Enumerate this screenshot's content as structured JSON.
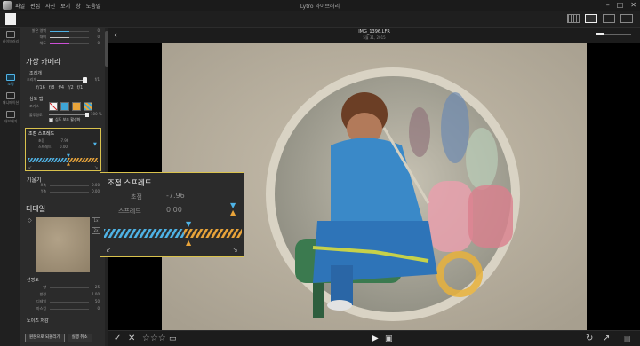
{
  "titlebar": {
    "menu": [
      "파일",
      "편집",
      "사진",
      "보기",
      "창",
      "도움말"
    ],
    "title": "Lytro 라이브러리",
    "controls": [
      "–",
      "□",
      "✕"
    ]
  },
  "rail": {
    "items": [
      {
        "label": "라이브러리",
        "icon": "library-icon"
      },
      {
        "label": "조정",
        "icon": "adjust-icon"
      },
      {
        "label": "애니메이션",
        "icon": "animation-icon"
      },
      {
        "label": "내보내기",
        "icon": "export-icon"
      }
    ]
  },
  "panel": {
    "top_sliders": [
      {
        "label": "밝은 영역",
        "value": "0",
        "color": "#4fb3e6",
        "fill": 0.5
      },
      {
        "label": "대비",
        "value": "0",
        "color": "#c9c9c9",
        "fill": 0.5
      },
      {
        "label": "채도",
        "value": "0",
        "color": "#cc4fd6",
        "fill": 0.5
      }
    ],
    "virtual_camera_title": "가상 카메라",
    "aperture_label": "조리개",
    "aperture_sub": "조리개",
    "aperture_value": "f/1",
    "fstops": [
      "f/16",
      "f/8",
      "f/4",
      "f/2",
      "f/1"
    ],
    "dof_label": "심도 맵",
    "dof_sub_1": "포커스",
    "dof_sub_2": "불투명도",
    "dof_opacity_value": "100 %",
    "dof_checkbox": "심도 보조 활성화",
    "focus_spread_small": {
      "title": "조점 스프레드",
      "focus_label": "초점",
      "focus_value": "-7.96",
      "spread_label": "스프레드",
      "spread_value": "0.00"
    },
    "tilt_title": "기울기",
    "tilt_rows": [
      {
        "label": "X축",
        "value": "0.00"
      },
      {
        "label": "Y축",
        "value": "0.00"
      }
    ],
    "detail_title": "디테일",
    "sharpen_title": "선명도",
    "sharpen_rows": [
      {
        "label": "양",
        "value": "25"
      },
      {
        "label": "반경",
        "value": "1.00"
      },
      {
        "label": "디테일",
        "value": "50"
      },
      {
        "label": "마스킹",
        "value": "0"
      }
    ],
    "noise_title": "노이즈 저감",
    "buttons": {
      "reset": "원본으로 되돌리기",
      "undo": "실행 취소"
    }
  },
  "viewer": {
    "filename": "IMG_1396.LFR",
    "date": "5월 31, 2015"
  },
  "callout": {
    "title": "조점 스프레드",
    "focus_label": "초점",
    "focus_value": "-7.96",
    "spread_label": "스프레드",
    "spread_value": "0.00",
    "focus_fraction": 0.58,
    "colors": {
      "near": "#4fb3e6",
      "far": "#e9a43a",
      "border": "#d9c24d"
    }
  },
  "bottombar": {
    "rating_stars": "☆☆☆",
    "play": "▶",
    "rotate": "↻",
    "export": "↗",
    "check": "✓",
    "reject": "✕"
  }
}
